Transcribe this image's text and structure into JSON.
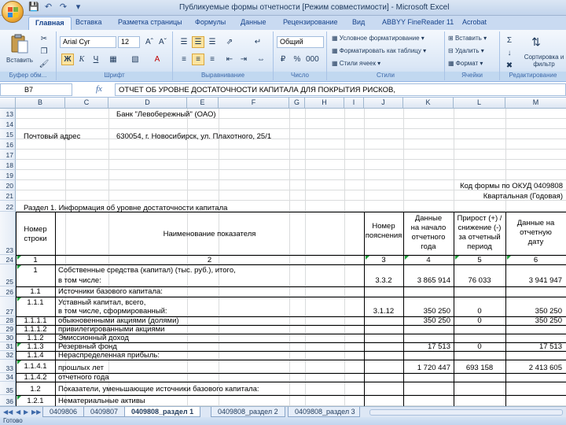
{
  "window": {
    "title": "Публикуемые формы отчетности [Режим совместимости] - Microsoft Excel"
  },
  "ribbon_tabs": [
    "Главная",
    "Вставка",
    "Разметка страницы",
    "Формулы",
    "Данные",
    "Рецензирование",
    "Вид",
    "ABBYY FineReader 11",
    "Acrobat"
  ],
  "ribbon": {
    "paste_label": "Вставить",
    "font_name": "Arial Cyr",
    "font_size": "12",
    "number_format": "Общий",
    "cond_format": "Условное форматирование",
    "format_table": "Форматировать как таблицу",
    "cell_styles": "Стили ячеек",
    "insert_cells": "Вставить",
    "delete_cells": "Удалить",
    "format_cells": "Формат",
    "sort_filter": "Сортировка и фильтр",
    "groups": [
      "Буфер обм...",
      "Шрифт",
      "Выравнивание",
      "Число",
      "Стили",
      "Ячейки",
      "Редактирование"
    ]
  },
  "formula_bar": {
    "name_box": "B7",
    "formula": "ОТЧЕТ ОБ УРОВНЕ ДОСТАТОЧНОСТИ КАПИТАЛА ДЛЯ ПОКРЫТИЯ РИСКОВ,"
  },
  "columns": [
    "B",
    "C",
    "D",
    "E",
    "F",
    "G",
    "H",
    "I",
    "J",
    "K",
    "L",
    "M"
  ],
  "rows": [
    "13",
    "14",
    "15",
    "16",
    "17",
    "18",
    "19",
    "20",
    "21",
    "22",
    "23",
    "24",
    "25",
    "26",
    "27",
    "28",
    "29",
    "30",
    "31",
    "32",
    "33",
    "34",
    "35",
    "36"
  ],
  "sheet": {
    "bank_name": "Банк \"Левобережный\" (ОАО)",
    "address_label": "Почтовый адрес",
    "address_value": "630054, г. Новосибирск, ул. Плахотного, 25/1",
    "okud_code": "Код формы по ОКУД 0409808",
    "period": "Квартальная (Годовая)",
    "section_title": "Раздел 1. Информация об уровне достаточности капитала",
    "headers": {
      "num": [
        "Номер",
        "строки"
      ],
      "name": "Наименование показателя",
      "note": [
        "Номер",
        "пояснения"
      ],
      "start": [
        "Данные",
        "на начало",
        "отчетного",
        "года"
      ],
      "change": [
        "Прирост (+) /",
        "снижение (-)",
        "за отчетный",
        "период"
      ],
      "end": [
        "Данные на",
        "отчетную",
        "дату"
      ]
    },
    "col_index": [
      "1",
      "2",
      "3",
      "4",
      "5",
      "6"
    ],
    "table_rows": [
      {
        "num": "1",
        "name1": "Собственные средства (капитал) (тыс. руб.), итого,",
        "name2": "в том числе:",
        "note": "3.3.2",
        "start": "3 865 914",
        "change": "76 033",
        "end": "3 941 947"
      },
      {
        "num": "1.1",
        "name1": "Источники базового капитала:",
        "name2": "",
        "note": "",
        "start": "",
        "change": "",
        "end": ""
      },
      {
        "num": "1.1.1",
        "name1": "Уставный капитал, всего,",
        "name2": "в том числе, сформированный:",
        "note": "3.1.12",
        "start": "350 250",
        "change": "0",
        "end": "350 250"
      },
      {
        "num": "1.1.1.1",
        "name1": "обыкновенными акциями (долями)",
        "name2": "",
        "note": "",
        "start": "350 250",
        "change": "0",
        "end": "350 250"
      },
      {
        "num": "1.1.1.2",
        "name1": "привилегированными акциями",
        "name2": "",
        "note": "",
        "start": "",
        "change": "",
        "end": ""
      },
      {
        "num": "1.1.2",
        "name1": "Эмиссионный доход",
        "name2": "",
        "note": "",
        "start": "",
        "change": "",
        "end": ""
      },
      {
        "num": "1.1.3",
        "name1": "Резервный фонд",
        "name2": "",
        "note": "",
        "start": "17 513",
        "change": "0",
        "end": "17 513"
      },
      {
        "num": "1.1.4",
        "name1": "Нераспределенная прибыль:",
        "name2": "",
        "note": "",
        "start": "",
        "change": "",
        "end": ""
      },
      {
        "num": "1.1.4.1",
        "name1": "прошлых лет",
        "name2": "",
        "note": "",
        "start": "1 720 447",
        "change": "693 158",
        "end": "2 413 605"
      },
      {
        "num": "1.1.4.2",
        "name1": "отчетного года",
        "name2": "",
        "note": "",
        "start": "",
        "change": "",
        "end": ""
      },
      {
        "num": "1.2",
        "name1": "Показатели, уменьшающие источники базового капитала:",
        "name2": "",
        "note": "",
        "start": "",
        "change": "",
        "end": ""
      },
      {
        "num": "1.2.1",
        "name1": "Нематериальные активы",
        "name2": "",
        "note": "",
        "start": "",
        "change": "",
        "end": ""
      }
    ]
  },
  "sheet_tabs": [
    "0409806",
    "0409807",
    "0409808_раздел 1",
    "0409808_раздел 2",
    "0409808_раздел 3"
  ],
  "status": "Готово",
  "colors": {
    "accent": "#15428b",
    "ribbon": "#dbe7f6",
    "marker": "#1f9e3a"
  }
}
